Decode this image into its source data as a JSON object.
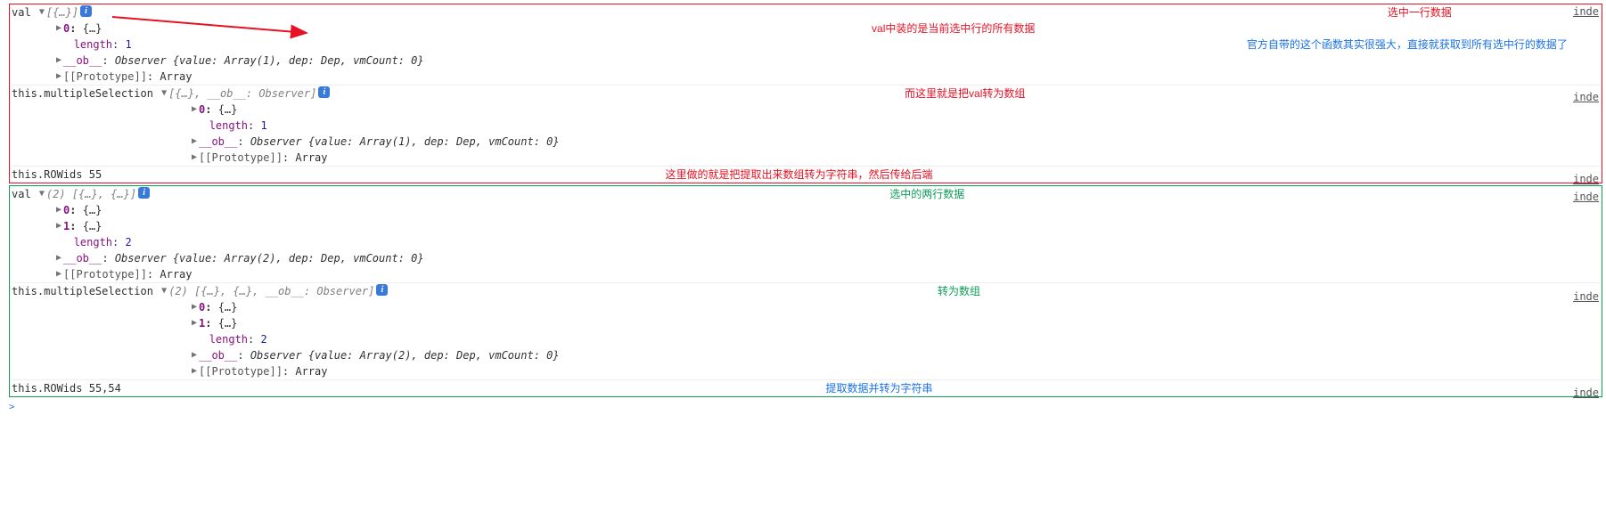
{
  "labels": {
    "val": "val",
    "multipleSelection": "this.multipleSelection",
    "rowids": "this.ROWids",
    "length": "length",
    "ob": "__ob__",
    "proto": "[[Prototype]]",
    "ObserverSig1": "Observer {value: Array(1), dep: Dep, vmCount: 0}",
    "ObserverSig2": "Observer {value: Array(2), dep: Dep, vmCount: 0}",
    "arrSig1": "[{…}]",
    "arrSig2": "[{…}, __ob__: Observer]",
    "arrSig3": "(2) [{…}, {…}]",
    "arrSig4": "(2) [{…}, {…}, __ob__: Observer]",
    "idx0": "0",
    "idx1": "1",
    "len1": "1",
    "len2": "2",
    "brace": "{…}",
    "Array": "Array",
    "rowids_val1": "55",
    "rowids_val2": "55,54",
    "inde": "inde"
  },
  "anno": {
    "r1": "选中一行数据",
    "r2": "val中装的是当前选中行的所有数据",
    "b1": "官方自带的这个函数其实很强大，直接就获取到所有选中行的数据了",
    "r3": "而这里就是把val转为数组",
    "r4": "这里做的就是把提取出来数组转为字符串，然后传给后端",
    "g1": "选中的两行数据",
    "g2": "转为数组",
    "b2": "提取数据并转为字符串"
  }
}
